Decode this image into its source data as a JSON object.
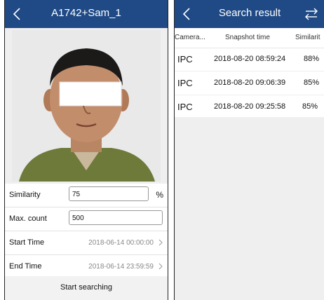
{
  "left": {
    "header": {
      "title": "A1742+Sam_1",
      "back_icon": "chevron-left-icon"
    },
    "form": {
      "similarity": {
        "label": "Similarity",
        "value": "75",
        "unit": "%"
      },
      "max_count": {
        "label": "Max. count",
        "value": "500"
      },
      "start_time": {
        "label": "Start Time",
        "value": "2018-06-14 00:00:00"
      },
      "end_time": {
        "label": "End Time",
        "value": "2018-06-14 23:59:59"
      }
    },
    "search_button": "Start searching"
  },
  "right": {
    "header": {
      "title": "Search result",
      "back_icon": "chevron-left-icon",
      "filter_icon": "filter-icon"
    },
    "columns": [
      "Camera...",
      "Snapshot time",
      "Similarit"
    ],
    "rows": [
      {
        "camera": "IPC",
        "time": "2018-08-20 08:59:24",
        "similarity": "88%"
      },
      {
        "camera": "IPC",
        "time": "2018-08-20 09:06:39",
        "similarity": "85%"
      },
      {
        "camera": "IPC",
        "time": "2018-08-20 09:25:58",
        "similarity": "85%"
      }
    ]
  },
  "colors": {
    "header_bg": "#1f4a86",
    "panel_bg": "#efefef"
  }
}
